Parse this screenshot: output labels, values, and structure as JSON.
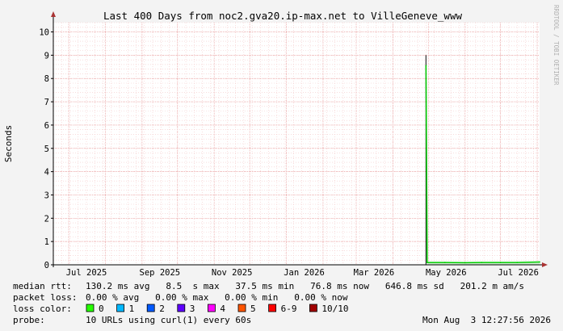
{
  "chart_data": {
    "type": "line",
    "title": "Last 400 Days from noc2.gva20.ip-max.net to VilleGeneve_www",
    "ylabel": "Seconds",
    "xlabel": "",
    "ylim": [
      0,
      10.4
    ],
    "yticks": [
      0,
      1,
      2,
      3,
      4,
      5,
      6,
      7,
      8,
      9,
      10
    ],
    "x_tick_labels": [
      "Jul 2025",
      "Sep 2025",
      "Nov 2025",
      "Jan 2026",
      "Mar 2026",
      "May 2026",
      "Jul 2026"
    ],
    "grid": true,
    "series": [
      {
        "name": "median rtt",
        "color": "#00cc00",
        "points": [
          [
            "2026-04-29",
            8.55
          ],
          [
            "2026-04-30",
            0.1
          ],
          [
            "2026-05-15",
            0.1
          ],
          [
            "2026-06-01",
            0.09
          ],
          [
            "2026-06-15",
            0.1
          ],
          [
            "2026-07-01",
            0.1
          ],
          [
            "2026-07-15",
            0.1
          ],
          [
            "2026-08-03",
            0.12
          ]
        ]
      }
    ],
    "spike": {
      "date": "2026-04-29",
      "max": 9.0,
      "min": 0.0
    }
  },
  "legend": {
    "median_rtt_label": "median rtt:",
    "median_rtt_values": "130.2 ms avg   8.5  s max   37.5 ms min   76.8 ms now   646.8 ms sd   201.2 m am/s",
    "packet_loss_label": "packet loss:",
    "packet_loss_values": "0.00 % avg   0.00 % max   0.00 % min   0.00 % now",
    "loss_color_label": "loss color:",
    "loss_colors": [
      {
        "label": "0",
        "color": "#26ff00"
      },
      {
        "label": "1",
        "color": "#00b8ff"
      },
      {
        "label": "2",
        "color": "#0059ff"
      },
      {
        "label": "3",
        "color": "#5e00ff"
      },
      {
        "label": "4",
        "color": "#ff00ff"
      },
      {
        "label": "5",
        "color": "#ff5500"
      },
      {
        "label": "6-9",
        "color": "#ff0000"
      },
      {
        "label": "10/10",
        "color": "#a10000"
      }
    ],
    "probe_label": "probe:",
    "probe_value": "10 URLs using curl(1) every 60s",
    "timestamp": "Mon Aug  3 12:27:56 2026"
  },
  "watermark": "RRDTOOL / TOBI OETIKER"
}
